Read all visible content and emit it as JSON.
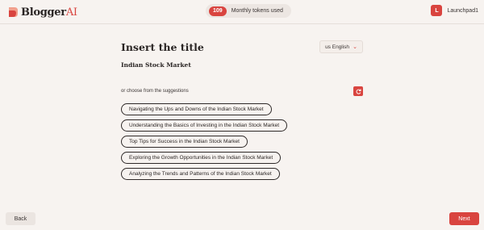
{
  "header": {
    "logo_main": "Blogger",
    "logo_accent": "AI",
    "token_count": "109",
    "token_label": "Monthly tokens used",
    "avatar_letter": "L",
    "user_name": "Launchpad1"
  },
  "main": {
    "title": "Insert the title",
    "language": "us English",
    "title_value": "Indian Stock Market",
    "suggestions_label": "or choose from the suggestions",
    "suggestions": [
      "Navigating the Ups and Downs of the Indian Stock Market",
      "Understanding the Basics of Investing in the Indian Stock Market",
      "Top Tips for Success in the Indian Stock Market",
      "Exploring the Growth Opportunities in the Indian Stock Market",
      "Analyzing the Trends and Patterns of the Indian Stock Market"
    ]
  },
  "footer": {
    "back_label": "Back",
    "next_label": "Next"
  },
  "colors": {
    "accent": "#d9443f",
    "background": "#f7f3f0"
  },
  "icons": {
    "logo": "blogger-logo-icon",
    "refresh": "refresh-icon",
    "language_chevron": "chevron-down-icon"
  }
}
